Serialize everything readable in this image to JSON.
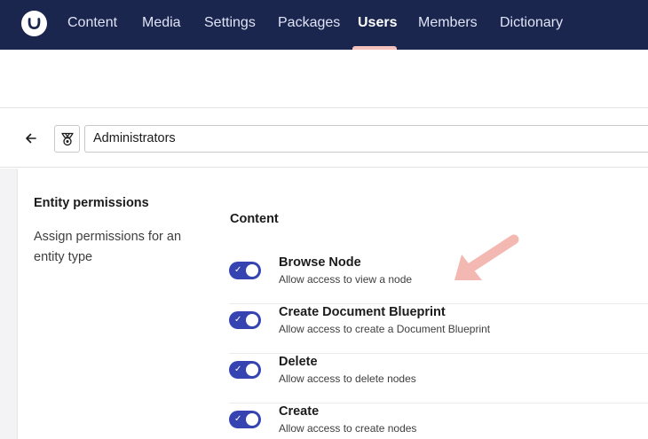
{
  "nav": {
    "items": [
      {
        "label": "Content",
        "active": false
      },
      {
        "label": "Media",
        "active": false
      },
      {
        "label": "Settings",
        "active": false
      },
      {
        "label": "Packages",
        "active": false
      },
      {
        "label": "Users",
        "active": true
      },
      {
        "label": "Members",
        "active": false
      },
      {
        "label": "Dictionary",
        "active": false
      }
    ],
    "logo_icon": "umbraco-logo-icon"
  },
  "header": {
    "back_icon": "arrow-left-icon",
    "group_icon": "medal-icon",
    "name_value": "Administrators"
  },
  "entity_permissions": {
    "title": "Entity permissions",
    "description": "Assign permissions for an entity type",
    "group_title": "Content",
    "permissions": [
      {
        "name": "Browse Node",
        "description": "Allow access to view a node",
        "enabled": true
      },
      {
        "name": "Create Document Blueprint",
        "description": "Allow access to create a Document Blueprint",
        "enabled": true
      },
      {
        "name": "Delete",
        "description": "Allow access to delete nodes",
        "enabled": true
      },
      {
        "name": "Create",
        "description": "Allow access to create nodes",
        "enabled": true
      }
    ]
  },
  "colors": {
    "nav_bg": "#1b264f",
    "toggle_on": "#3544b1",
    "active_underline": "#f5c1bc",
    "annotation_arrow": "#f4b8b2"
  }
}
